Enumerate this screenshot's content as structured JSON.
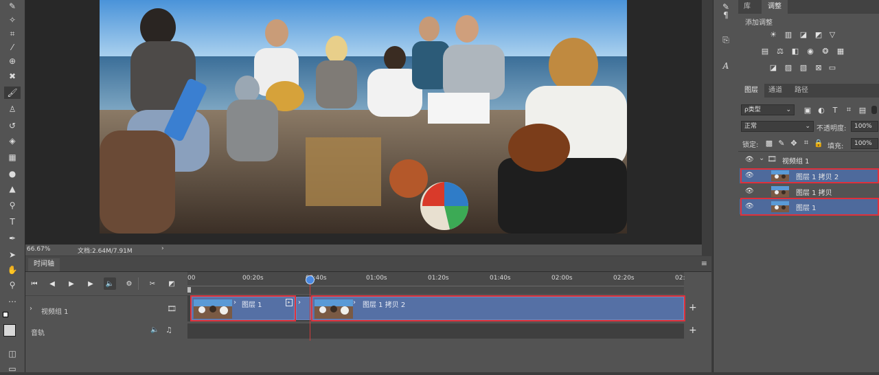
{
  "toolbar": {
    "tools": [
      "quick-selection-icon",
      "crop-icon",
      "eyedropper-icon",
      "spot-healing-icon",
      "brush-icon",
      "clone-stamp-icon",
      "history-brush-icon",
      "eraser-icon",
      "gradient-icon",
      "blur-icon",
      "dodge-icon",
      "pen-icon",
      "type-icon",
      "path-selection-icon",
      "shape-icon",
      "hand-icon",
      "zoom-icon",
      "more-icon"
    ]
  },
  "status": {
    "zoom": "66.67%",
    "doc": "文档:2.64M/7.91M",
    "arrow": "›"
  },
  "timeline": {
    "tab_label": "时间轴",
    "menu_glyph": "≡",
    "ruler_ticks": [
      "00",
      "00:20s",
      "00:40s",
      "01:00s",
      "01:20s",
      "01:40s",
      "02:00s",
      "02:20s",
      "02:"
    ],
    "tracks": {
      "video_group": "视频组 1",
      "audio": "音轨"
    },
    "clips": [
      {
        "label": "图层 1"
      },
      {
        "label": "图层 1 拷贝 2"
      }
    ],
    "add_glyph": "+",
    "playhead_position_fraction": 0.245
  },
  "mini_panel": {
    "icons": [
      "paragraph-icon",
      "glyphs-icon",
      "character-icon"
    ]
  },
  "adjustments": {
    "tab_left": "库",
    "tab_active": "调整",
    "title": "添加调整"
  },
  "layers": {
    "tabs": [
      "图层",
      "通道",
      "路径"
    ],
    "filter_label": "ρ类型",
    "blend_mode": "正常",
    "opacity_label": "不透明度:",
    "opacity_value": "100%",
    "lock_label": "锁定:",
    "fill_label": "填充:",
    "fill_value": "100%",
    "group_name": "视频组 1",
    "items": [
      {
        "name": "图层 1 拷贝 2",
        "selected": true
      },
      {
        "name": "图层 1 拷贝",
        "selected": false
      },
      {
        "name": "图层 1",
        "selected": true
      }
    ]
  },
  "colors": {
    "highlight_red": "#e0303a",
    "clip_blue": "#5570a5",
    "selection_blue": "#4e6a9c"
  }
}
